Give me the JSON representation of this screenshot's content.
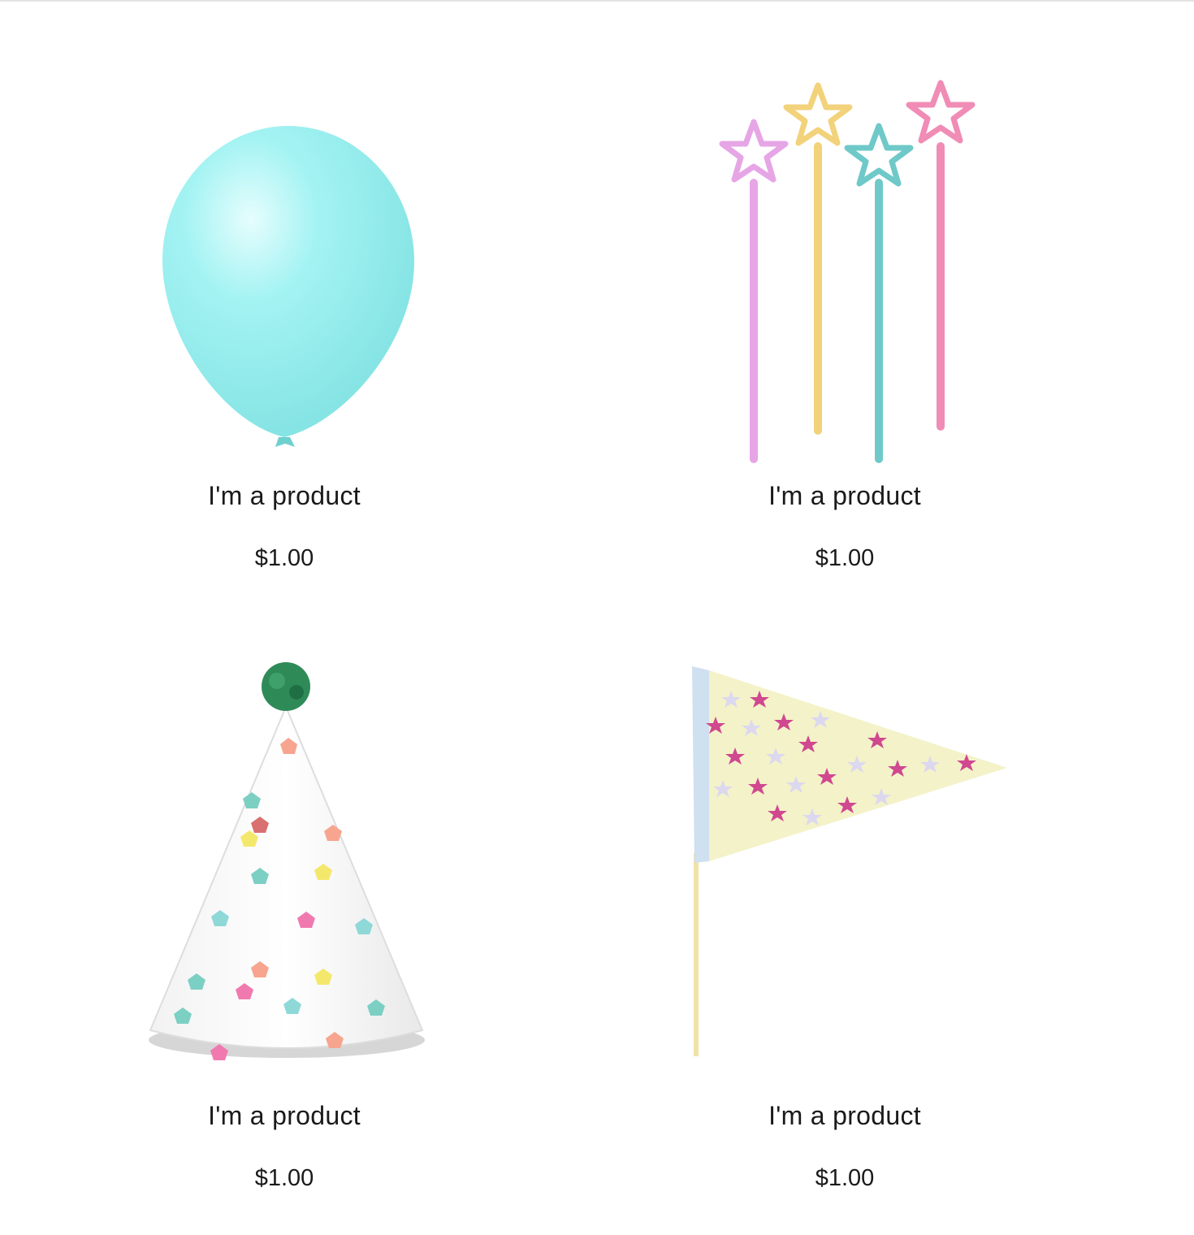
{
  "products": [
    {
      "name": "I'm a product",
      "price": "$1.00",
      "image_icon": "balloon-icon",
      "image_color": "#9ef0ef"
    },
    {
      "name": "I'm a product",
      "price": "$1.00",
      "image_icon": "star-wands-icon",
      "image_colors": [
        "#e6a6e6",
        "#f2d27a",
        "#6fc9c9",
        "#f08cb6"
      ]
    },
    {
      "name": "I'm a product",
      "price": "$1.00",
      "image_icon": "party-hat-icon",
      "image_color": "#2e8b57"
    },
    {
      "name": "I'm a product",
      "price": "$1.00",
      "image_icon": "pennant-flag-icon",
      "image_colors": [
        "#f4f2c9",
        "#d0488f",
        "#cfe0f0"
      ]
    }
  ]
}
